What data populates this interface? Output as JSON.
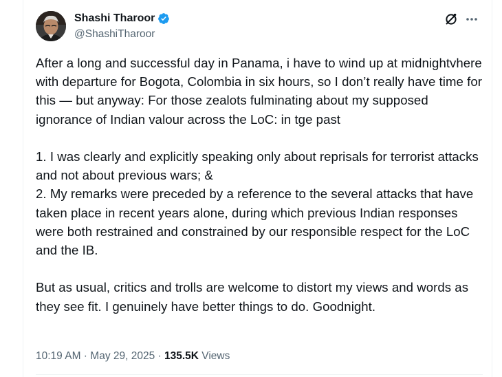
{
  "author": {
    "display_name": "Shashi Tharoor",
    "handle": "@ShashiTharoor",
    "verified": true,
    "verified_color": "#1d9bf0"
  },
  "actions": {
    "grok_icon": "grok-icon",
    "more_icon": "more-icon"
  },
  "tweet": {
    "paragraphs": [
      "After a long and successful day in Panama, i have to wind up at midnightvhere with departure for Bogota, Colombia in six hours, so I don’t really have time for this — but anyway: For those zealots fulminating about my supposed ignorance of Indian valour across the LoC: in tge past",
      "1. I was clearly and explicitly speaking only about reprisals for terrorist attacks and not about previous wars; &",
      "2. My remarks were preceded by a reference to the several attacks that have taken place in recent years alone, during which previous Indian responses were both restrained and constrained by our responsible respect for the LoC and the IB.",
      "But as usual, critics and trolls are welcome to distort my views and words as they see fit. I genuinely have better things to do. Goodnight."
    ]
  },
  "meta": {
    "time": "10:19 AM",
    "separator": " · ",
    "date": "May 29, 2025",
    "separator2": " · ",
    "views_count": "135.5K",
    "views_label": " Views"
  },
  "colors": {
    "text_primary": "#0f1419",
    "text_secondary": "#536471",
    "border": "#eff3f4"
  }
}
